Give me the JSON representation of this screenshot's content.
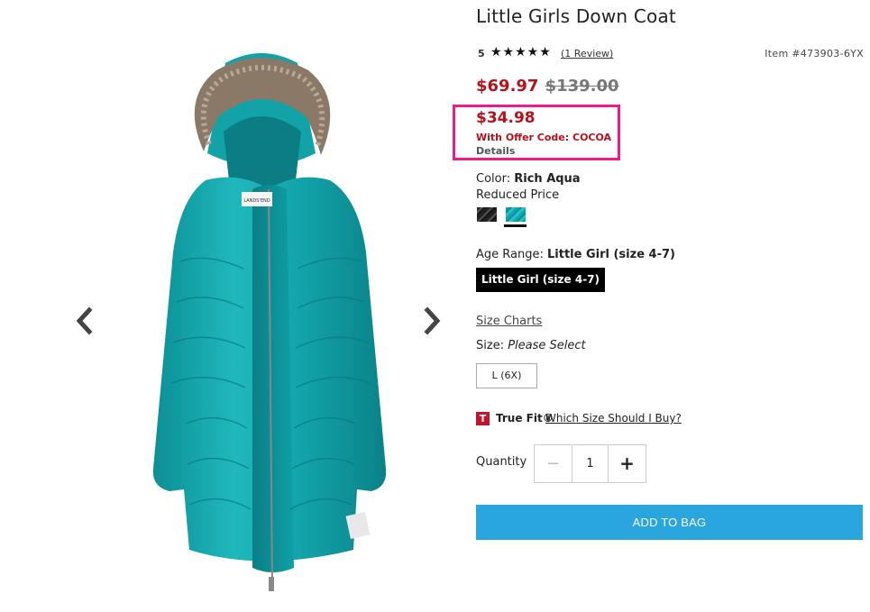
{
  "product": {
    "title": "Little Girls Down Coat",
    "rating_value": "5",
    "stars": "★★★★★",
    "review_link": "(1 Review)",
    "item_number": "Item #473903-6YX"
  },
  "pricing": {
    "sale_price": "$69.97",
    "original_price": "$139.00",
    "offer_price": "$34.98",
    "offer_code_text": "With Offer Code: COCOA",
    "details_link": "Details",
    "offer_highlight_color": "#ee1a8e",
    "price_color": "#b5121b"
  },
  "color": {
    "label": "Color:",
    "selected": "Rich Aqua",
    "status": "Reduced Price",
    "swatches": [
      "Black",
      "Rich Aqua"
    ]
  },
  "age_range": {
    "label": "Age Range:",
    "selected": "Little Girl (size 4-7)",
    "button_label": "Little Girl (size 4-7)"
  },
  "size": {
    "charts_link": "Size Charts",
    "label": "Size:",
    "prompt": "Please Select",
    "options": [
      "L (6X)"
    ]
  },
  "truefit": {
    "icon_letter": "T",
    "brand": "True Fit®",
    "link": "Which Size Should I Buy?"
  },
  "quantity": {
    "label": "Quantity",
    "value": "1",
    "minus": "−",
    "plus": "+"
  },
  "cart": {
    "add_button": "ADD TO BAG",
    "button_color": "#2aa6de"
  },
  "gallery": {
    "tag_text": "LANDS'END"
  },
  "icons": {
    "prev": "chevron-left-icon",
    "next": "chevron-right-icon"
  }
}
